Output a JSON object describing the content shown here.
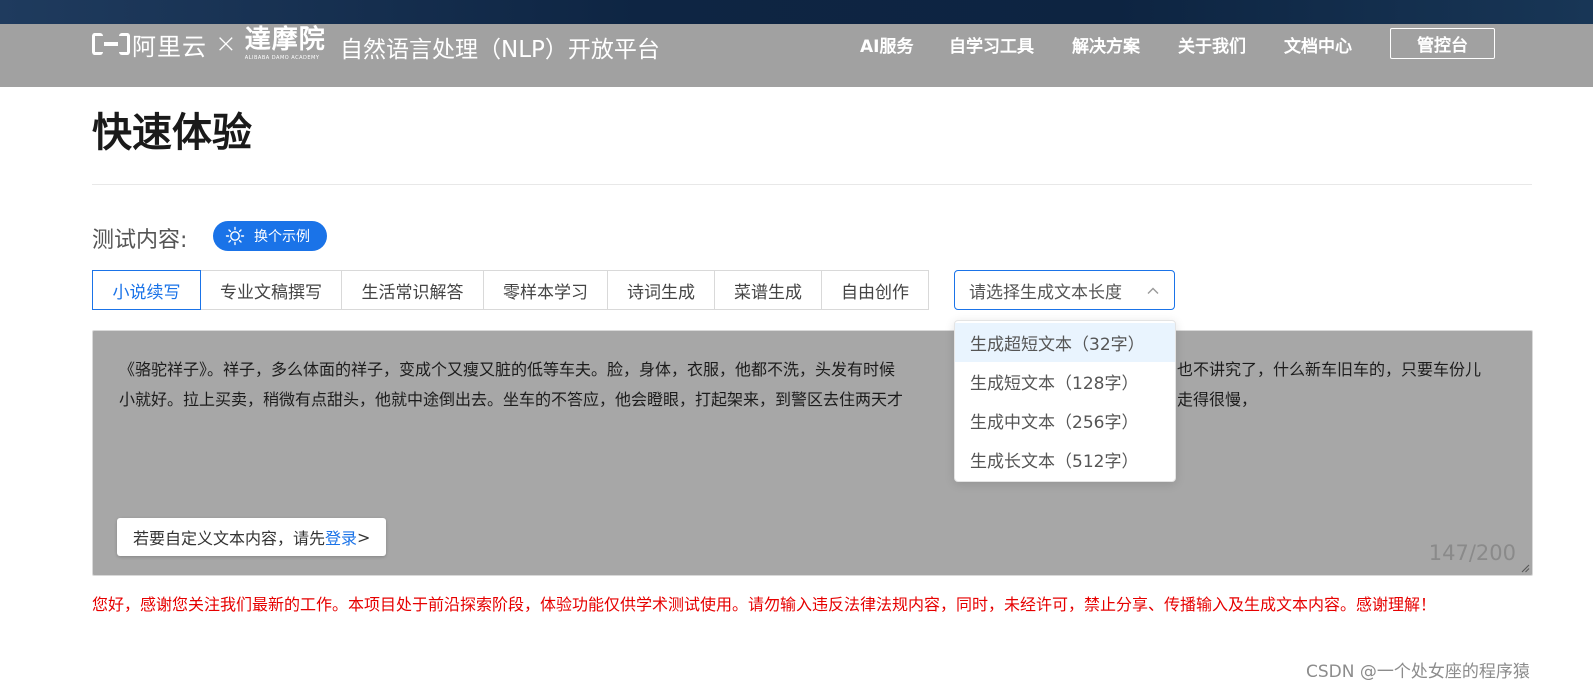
{
  "header": {
    "logo_aliyun": "阿里云",
    "logo_x": "×",
    "logo_damo": "達摩院",
    "logo_damo_en": "ALIBABA DAMO ACADEMY",
    "platform_title": "自然语言处理（NLP）开放平台",
    "nav": [
      "AI服务",
      "自学习工具",
      "解决方案",
      "关于我们",
      "文档中心"
    ],
    "console_label": "管控台"
  },
  "main": {
    "heading": "快速体验",
    "test_label": "测试内容:",
    "example_button": "换个示例",
    "tabs": [
      "小说续写",
      "专业文稿撰写",
      "生活常识解答",
      "零样本学习",
      "诗词生成",
      "菜谱生成",
      "自由创作"
    ],
    "active_tab": "小说续写",
    "select_placeholder": "请选择生成文本长度",
    "select_options": [
      "生成超短文本（32字）",
      "生成短文本（128字）",
      "生成中文本（256字）",
      "生成长文本（512字）"
    ],
    "text_line1_a": "《骆驼祥子》。祥子，多么体面的祥子，变成个又瘦又脏的低等车夫。脸，身体，衣服，他都不洗，头发有时候",
    "text_line1_b": "也不讲究了，什么新车旧车的，只要车份儿",
    "text_line2_a": "小就好。拉上买卖，稍微有点甜头，他就中途倒出去。坐车的不答应，他会瞪眼，打起架来，到警区去住两天才",
    "text_line2_b": "走得很慢，",
    "login_hint_prefix": "若要自定义文本内容，请先",
    "login_link": "登录",
    "login_hint_suffix": ">",
    "char_counter": "147/200",
    "notice": "您好，感谢您关注我们最新的工作。本项目处于前沿探索阶段，体验功能仅供学术测试使用。请勿输入违反法律法规内容，同时，未经许可，禁止分享、传播输入及生成文本内容。感谢理解！"
  },
  "watermark": "CSDN @一个处女座的程序猿",
  "colors": {
    "accent": "#1a73e8",
    "navbar": "#a1a1a1",
    "textarea_bg": "#a7a7a7",
    "notice": "#e60000",
    "dropdown_hover": "#e9f4fe"
  }
}
